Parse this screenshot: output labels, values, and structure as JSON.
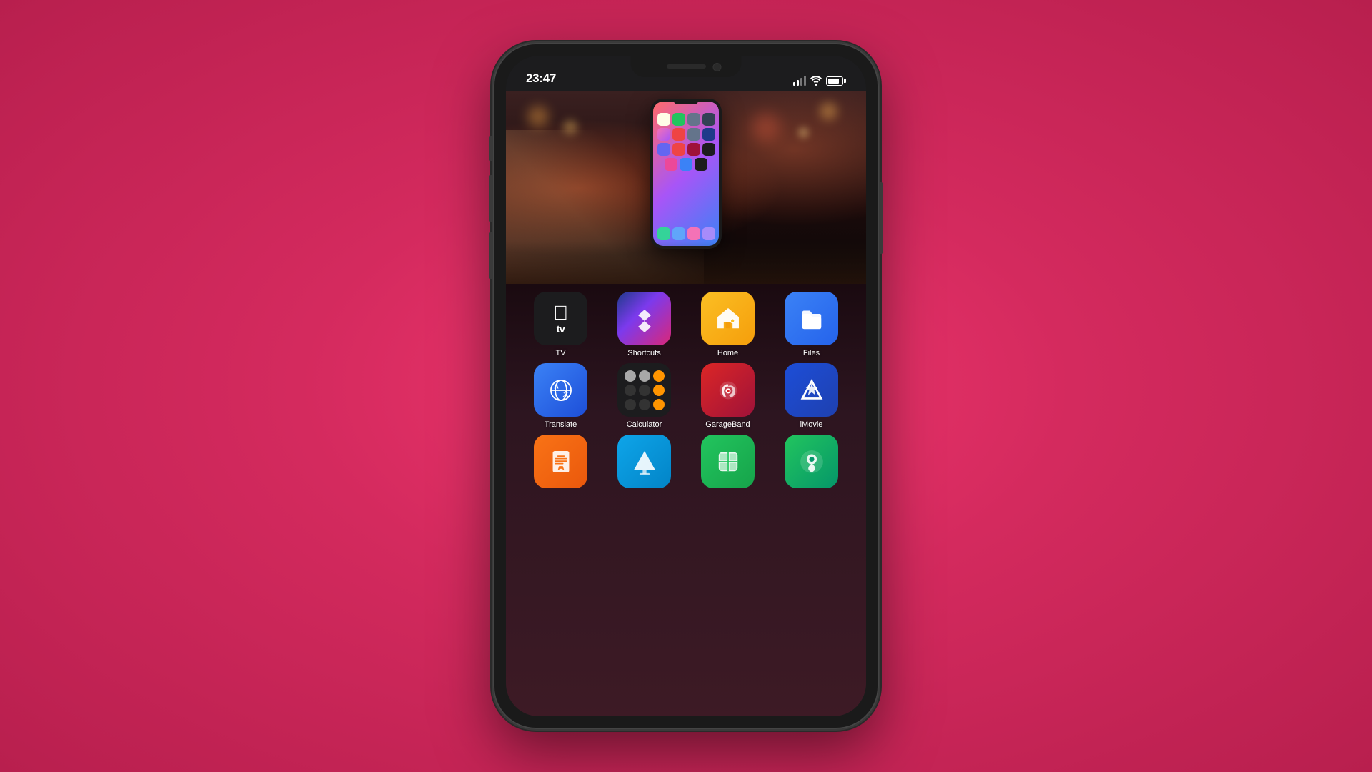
{
  "background_color": "#d42a5e",
  "phone": {
    "status_bar": {
      "time": "23:47",
      "signal_label": "signal",
      "wifi_label": "wifi",
      "battery_label": "battery"
    },
    "apps": {
      "row1": [
        {
          "id": "tv",
          "label": "TV",
          "icon_type": "tv"
        },
        {
          "id": "shortcuts",
          "label": "Shortcuts",
          "icon_type": "shortcuts"
        },
        {
          "id": "home",
          "label": "Home",
          "icon_type": "home"
        },
        {
          "id": "files",
          "label": "Files",
          "icon_type": "files"
        }
      ],
      "row2": [
        {
          "id": "translate",
          "label": "Translate",
          "icon_type": "translate"
        },
        {
          "id": "calculator",
          "label": "Calculator",
          "icon_type": "calculator"
        },
        {
          "id": "garageband",
          "label": "GarageBand",
          "icon_type": "garageband"
        },
        {
          "id": "imovie",
          "label": "iMovie",
          "icon_type": "imovie"
        }
      ],
      "row3": [
        {
          "id": "pages",
          "label": "Pages",
          "icon_type": "pages"
        },
        {
          "id": "keynote",
          "label": "Keynote",
          "icon_type": "keynote"
        },
        {
          "id": "numbers",
          "label": "Numbers",
          "icon_type": "numbers"
        },
        {
          "id": "findmy",
          "label": "Find My",
          "icon_type": "findmy"
        }
      ]
    }
  }
}
